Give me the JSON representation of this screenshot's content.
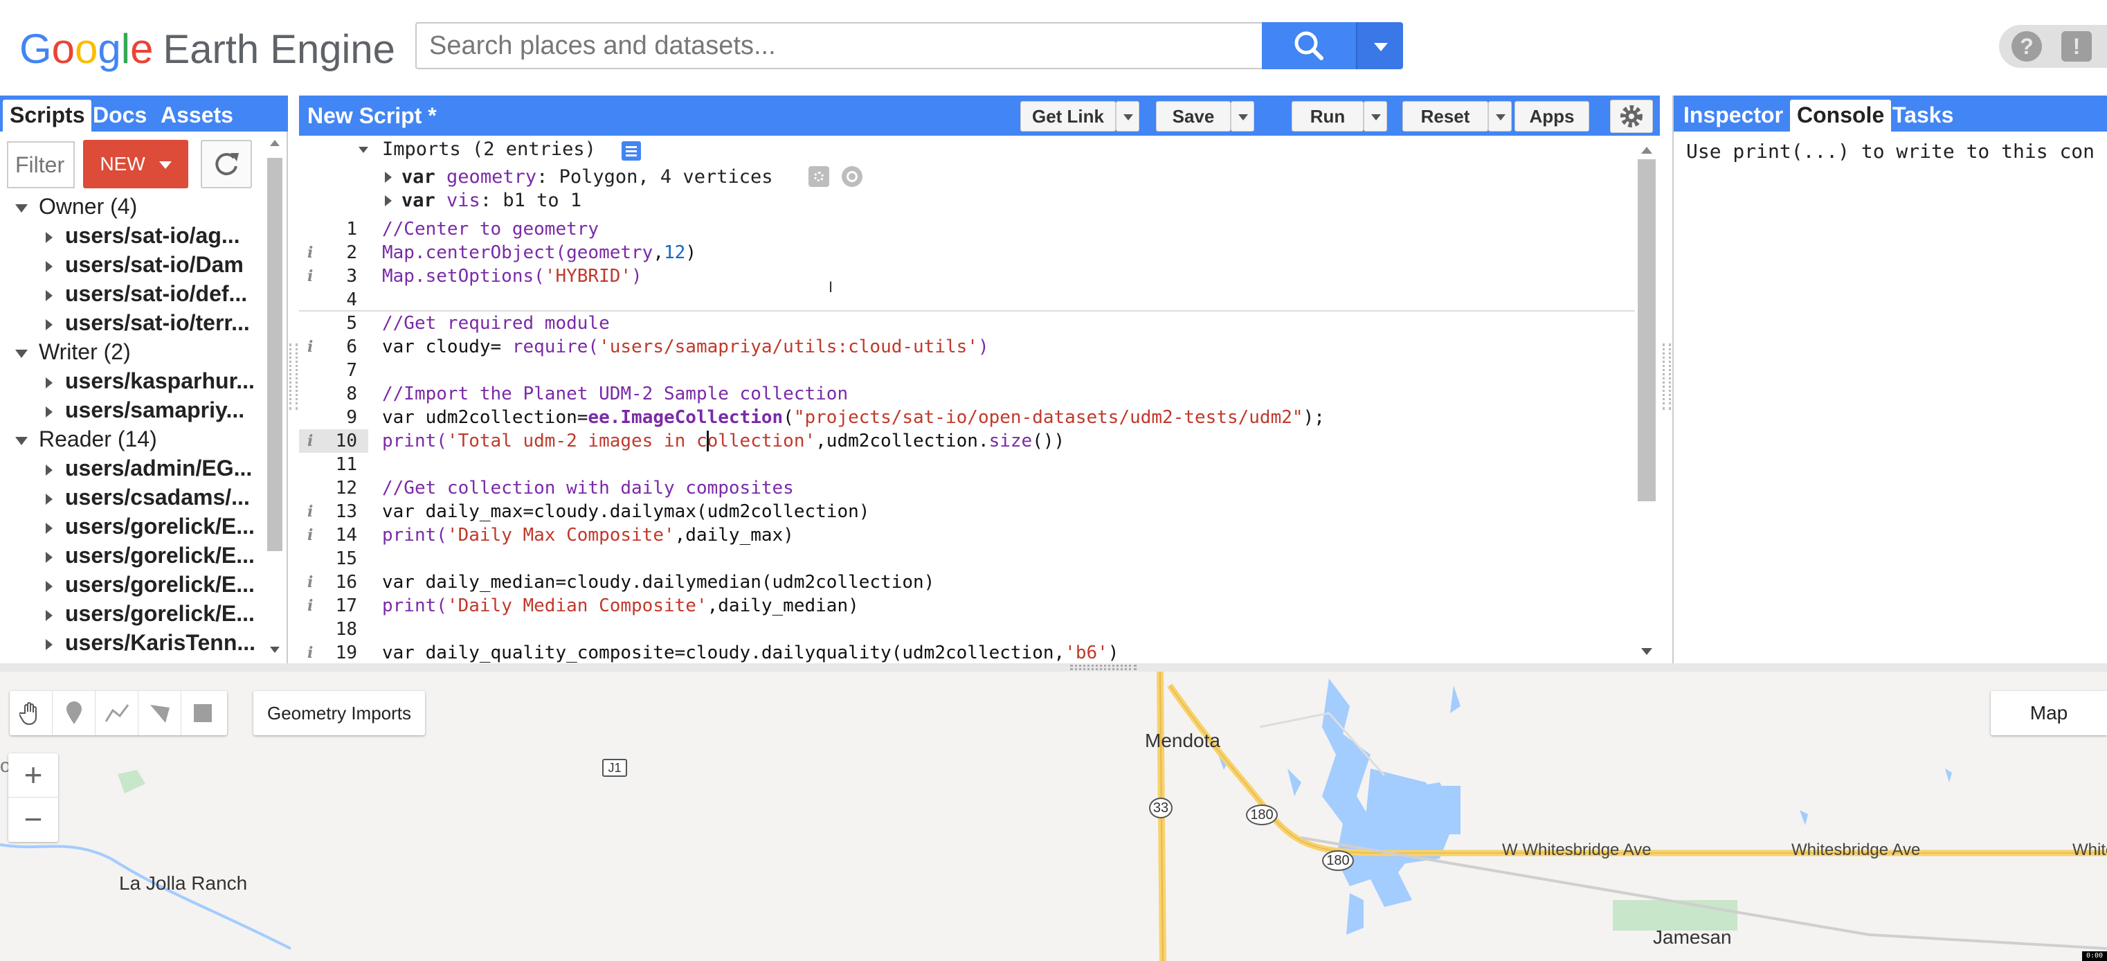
{
  "header": {
    "logo_google": "Google",
    "logo_product": "Earth Engine",
    "search_placeholder": "Search places and datasets...",
    "help_icon": "question-icon",
    "feedback_icon": "feedback-icon"
  },
  "left_panel": {
    "tabs": [
      {
        "label": "Scripts",
        "active": true
      },
      {
        "label": "Docs",
        "active": false
      },
      {
        "label": "Assets",
        "active": false
      }
    ],
    "filter_placeholder": "Filter",
    "new_button": "NEW",
    "groups": [
      {
        "label": "Owner (4)",
        "items": [
          "users/sat-io/ag...",
          "users/sat-io/Dam",
          "users/sat-io/def...",
          "users/sat-io/terr..."
        ]
      },
      {
        "label": "Writer (2)",
        "items": [
          "users/kasparhur...",
          "users/samapriy..."
        ]
      },
      {
        "label": "Reader (14)",
        "items": [
          "users/admin/EG...",
          "users/csadams/...",
          "users/gorelick/E...",
          "users/gorelick/E...",
          "users/gorelick/E...",
          "users/gorelick/E...",
          "users/KarisTenn..."
        ]
      }
    ]
  },
  "editor": {
    "title": "New Script *",
    "toolbar": {
      "get_link": "Get Link",
      "save": "Save",
      "run": "Run",
      "reset": "Reset",
      "apps": "Apps"
    },
    "imports_header": "Imports (2 entries)",
    "imports": [
      {
        "kw": "var",
        "name": "geometry",
        "value": "Polygon, 4 vertices"
      },
      {
        "kw": "var",
        "name": "vis",
        "value": "b1 to 1"
      }
    ],
    "active_line": 10,
    "lines": [
      {
        "n": "1",
        "info": false
      },
      {
        "n": "2",
        "info": true
      },
      {
        "n": "3",
        "info": true
      },
      {
        "n": "4",
        "info": false
      },
      {
        "n": "5",
        "info": false
      },
      {
        "n": "6",
        "info": true
      },
      {
        "n": "7",
        "info": false
      },
      {
        "n": "8",
        "info": false
      },
      {
        "n": "9",
        "info": false
      },
      {
        "n": "10",
        "info": true
      },
      {
        "n": "11",
        "info": false
      },
      {
        "n": "12",
        "info": false
      },
      {
        "n": "13",
        "info": true
      },
      {
        "n": "14",
        "info": true
      },
      {
        "n": "15",
        "info": false
      },
      {
        "n": "16",
        "info": true
      },
      {
        "n": "17",
        "info": true
      },
      {
        "n": "18",
        "info": false
      },
      {
        "n": "19",
        "info": true
      }
    ],
    "code": {
      "l1": "//Center to geometry",
      "l2a": "Map.centerObject(",
      "l2b": "geometry",
      "l2c": ",",
      "l2d": "12",
      "l2e": ")",
      "l3a": "Map.setOptions(",
      "l3b": "'HYBRID'",
      "l3c": ")",
      "l5": "//Get required module",
      "l6a": "var cloudy= ",
      "l6b": "require(",
      "l6c": "'users/samapriya/utils:cloud-utils'",
      "l6d": ")",
      "l8": "//Import the Planet UDM-2 Sample collection",
      "l9a": "var udm2collection=",
      "l9b": "ee.ImageCollection",
      "l9c": "(",
      "l9d": "\"projects/sat-io/open-datasets/udm2-tests/udm2\"",
      "l9e": ");",
      "l10a": "print(",
      "l10b": "'Total udm-2 images in collection'",
      "l10c": ",udm2collection.",
      "l10d": "size",
      "l10e": "())",
      "l12": "//Get collection with daily composites",
      "l13": "var daily_max=cloudy.dailymax(udm2collection)",
      "l14a": "print(",
      "l14b": "'Daily Max Composite'",
      "l14c": ",daily_max)",
      "l16": "var daily_median=cloudy.dailymedian(udm2collection)",
      "l17a": "print(",
      "l17b": "'Daily Median Composite'",
      "l17c": ",daily_median)",
      "l19a": "var daily_quality_composite=cloudy.dailyquality(udm2collection,",
      "l19b": "'b6'",
      "l19c": ")"
    }
  },
  "right_panel": {
    "tabs": [
      {
        "label": "Inspector",
        "active": false
      },
      {
        "label": "Console",
        "active": true
      },
      {
        "label": "Tasks",
        "active": false
      }
    ],
    "console_text": "Use print(...) to write to this con"
  },
  "map": {
    "geometry_imports": "Geometry Imports",
    "map_type": "Map",
    "zoom_in": "+",
    "zoom_out": "−",
    "labels": {
      "mendota": "Mendota",
      "la_jolla_ranch": "La Jolla Ranch",
      "ranch_partial": "ch",
      "jamesan": "Jamesan",
      "w_whitesbridge": "W Whitesbridge Ave",
      "whitesbridge": "Whitesbridge Ave",
      "white_partial": "White",
      "r33": "33",
      "r180a": "180",
      "r180b": "180",
      "j1": "J1"
    },
    "colors": {
      "water": "#a3ccff",
      "road": "#f8d26c",
      "park": "#c8e6c9"
    }
  },
  "colors": {
    "accent": "#4285f4",
    "new_button": "#dd4b39"
  },
  "timestamp": "0:00"
}
